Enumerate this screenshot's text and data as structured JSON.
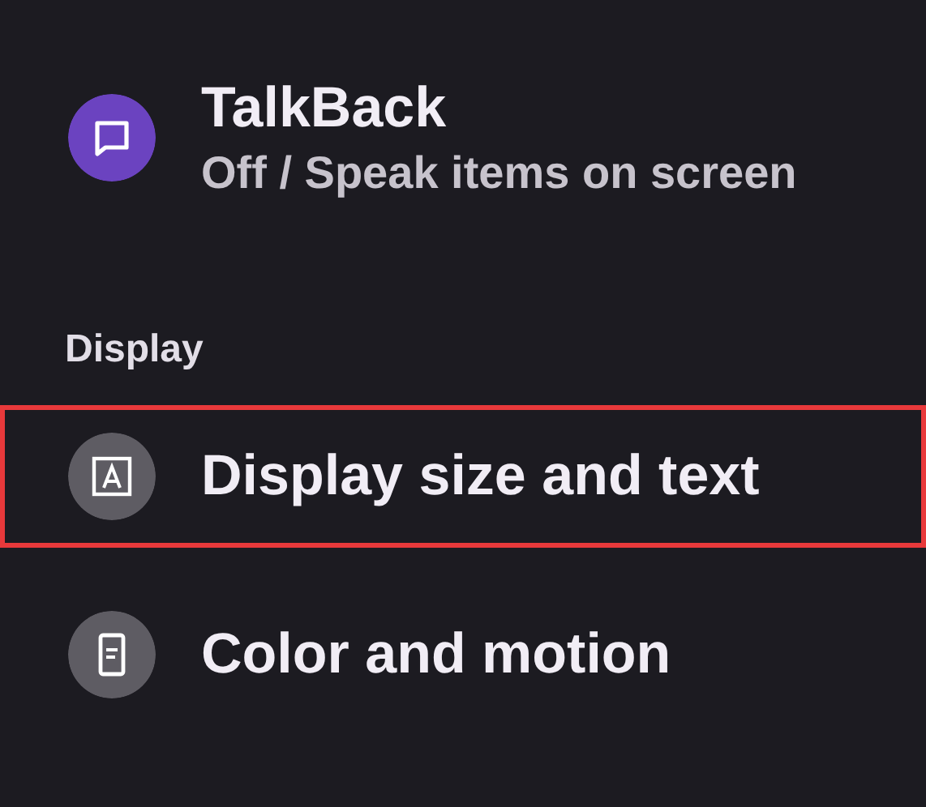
{
  "rows": [
    {
      "kind": "speech",
      "title": "TalkBack",
      "subtitle": "Off / Speak items on screen",
      "highlighted": false
    },
    {
      "kind": "header",
      "title": "Display"
    },
    {
      "kind": "textsize",
      "title": "Display size and text",
      "highlighted": true
    },
    {
      "kind": "phone",
      "title": "Color and motion",
      "highlighted": false
    }
  ]
}
